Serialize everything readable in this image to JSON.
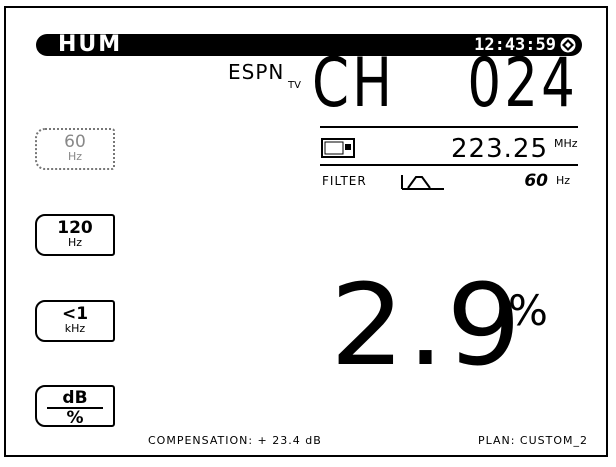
{
  "header": {
    "mode": "HUM",
    "time": "12:43:59",
    "status_icon": "satellite-lock-icon"
  },
  "channel": {
    "network": "ESPN",
    "network_sub": "TV",
    "label": "CH",
    "number": "024"
  },
  "frequency": {
    "signal_icon": "screen-icon",
    "value": "223.25",
    "unit": "MHz"
  },
  "filter": {
    "label": "FILTER",
    "icon": "bandpass-filter-icon",
    "value": "60",
    "unit": "Hz"
  },
  "softkeys": [
    {
      "top": "60",
      "bottom": "Hz",
      "enabled": false
    },
    {
      "top": "120",
      "bottom": "Hz",
      "enabled": true
    },
    {
      "top": "<1",
      "bottom": "kHz",
      "enabled": true
    },
    {
      "top": "dB",
      "bottom": "%",
      "enabled": true
    }
  ],
  "reading": {
    "value": "2.9",
    "unit": "%"
  },
  "footer": {
    "compensation": "COMPENSATION: + 23.4 dB",
    "plan": "PLAN: CUSTOM_2"
  }
}
